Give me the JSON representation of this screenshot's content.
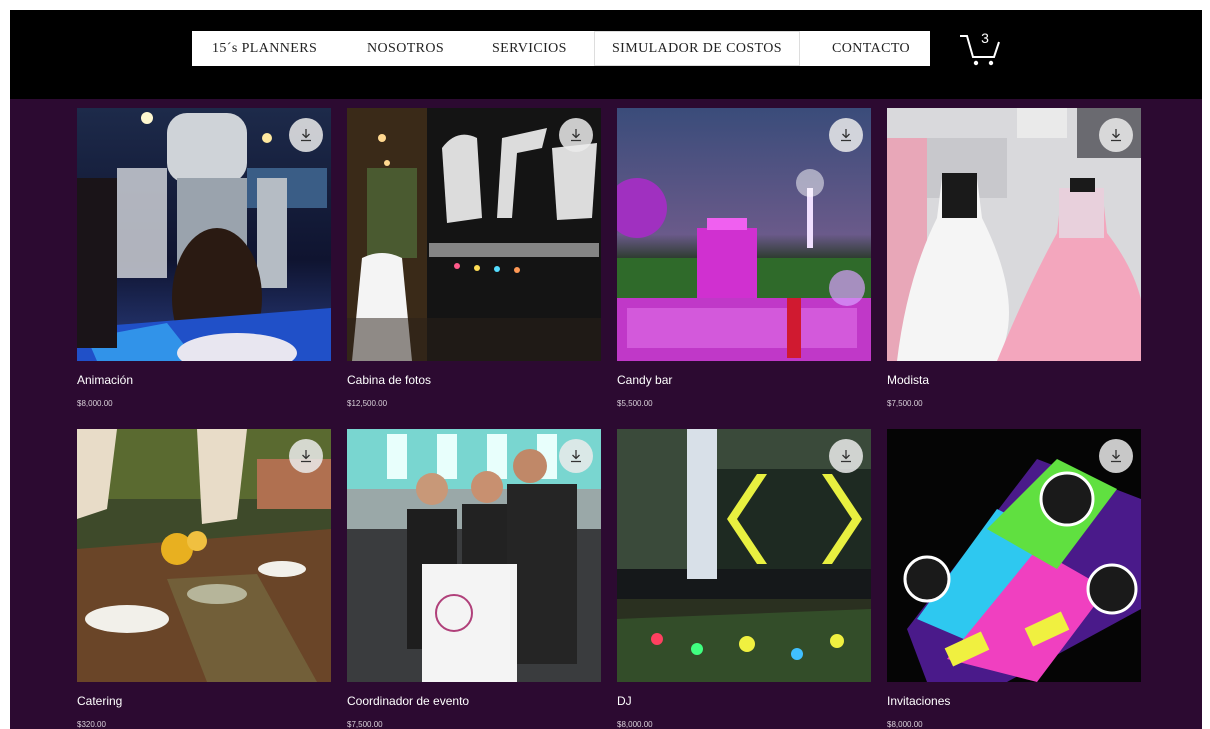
{
  "nav": {
    "items": [
      {
        "label": "15´s PLANNERS"
      },
      {
        "label": "NOSOTROS"
      },
      {
        "label": "SERVICIOS"
      },
      {
        "label": "SIMULADOR DE COSTOS"
      },
      {
        "label": "CONTACTO"
      }
    ]
  },
  "cart": {
    "count": "3",
    "icon": "cart-icon"
  },
  "products": [
    {
      "name": "Animación",
      "price": "$8,000.00"
    },
    {
      "name": "Cabina de fotos",
      "price": "$12,500.00"
    },
    {
      "name": "Candy bar",
      "price": "$5,500.00"
    },
    {
      "name": "Modista",
      "price": "$7,500.00"
    },
    {
      "name": "Catering",
      "price": "$320.00"
    },
    {
      "name": "Coordinador de evento",
      "price": "$7,500.00"
    },
    {
      "name": "DJ",
      "price": "$8,000.00"
    },
    {
      "name": "Invitaciones",
      "price": "$8,000.00"
    }
  ],
  "colors": {
    "background": "#2c0a31",
    "header": "#000000",
    "nav": "#ffffff"
  }
}
